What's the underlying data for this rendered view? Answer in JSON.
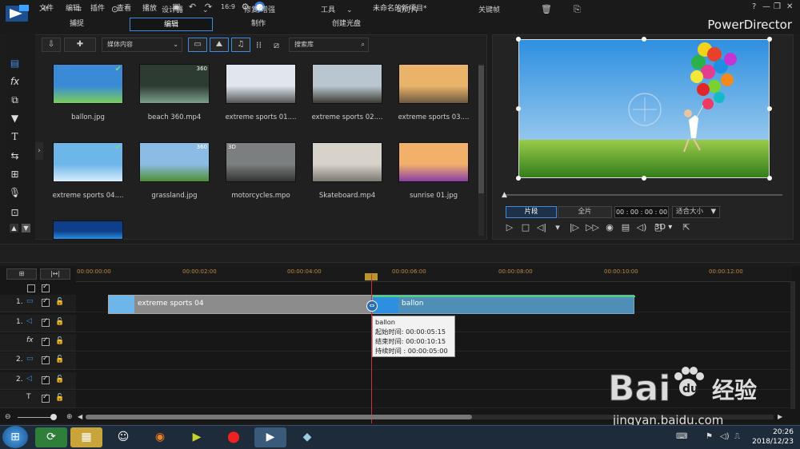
{
  "menu": [
    "文件",
    "编辑",
    "插件",
    "查看",
    "播放"
  ],
  "window_title": "未命名的新项目*",
  "brand": "PowerDirector",
  "tabs": [
    {
      "label": "捕捉"
    },
    {
      "label": "编辑"
    },
    {
      "label": "制作"
    },
    {
      "label": "创建光盘"
    }
  ],
  "library": {
    "dropdown": "媒体内容",
    "search_placeholder": "搜索库",
    "items": [
      {
        "label": "ballon.jpg",
        "colors": [
          "#3a8ad6",
          "#7ccf5a"
        ],
        "check": true
      },
      {
        "label": "beach 360.mp4",
        "colors": [
          "#2e3b33",
          "#7aa08a"
        ],
        "badge": "360"
      },
      {
        "label": "extreme sports 01....",
        "colors": [
          "#dfe6ee",
          "#555"
        ]
      },
      {
        "label": "extreme sports 02....",
        "colors": [
          "#b9c6cf",
          "#3c3a33"
        ]
      },
      {
        "label": "extreme sports 03....",
        "colors": [
          "#e9b36a",
          "#6d5940"
        ]
      },
      {
        "label": "extreme sports 04....",
        "colors": [
          "#6db6ea",
          "#d7ecfb"
        ],
        "check": true
      },
      {
        "label": "grassland.jpg",
        "colors": [
          "#8cbbe6",
          "#4f8f2f"
        ],
        "badge": "360"
      },
      {
        "label": "motorcycles.mpo",
        "colors": [
          "#7c7f80",
          "#333"
        ],
        "badge3d": "3D"
      },
      {
        "label": "Skateboard.mp4",
        "colors": [
          "#d7d2ca",
          "#7d7a73"
        ]
      },
      {
        "label": "sunrise 01.jpg",
        "colors": [
          "#f2b06a",
          "#8a3ea8"
        ]
      },
      {
        "label": "",
        "colors": [
          "#0e3f8a",
          "#2a8ee0"
        ]
      }
    ]
  },
  "preview": {
    "mode_clip": "片段",
    "mode_full": "全片",
    "timecode": "00 : 00 : 00 : 00",
    "zoom": "适合大小",
    "mode3d": "3D"
  },
  "midbar": {
    "designer": "设计器",
    "repair": "修复/增强",
    "tools": "工具",
    "slideshow": "幻灯片",
    "keyframe": "关键帧"
  },
  "ruler": [
    "00:00:00:00",
    "00:00:02:00",
    "00:00:04:00",
    "00:00:06:00",
    "00:00:08:00",
    "00:00:10:00",
    "00:00:12:00"
  ],
  "tracks": [
    {
      "num": "1.",
      "icon": "video-track-icon"
    },
    {
      "num": "1.",
      "icon": "audio-track-icon"
    },
    {
      "num": "",
      "icon": "fx-track-icon"
    },
    {
      "num": "2.",
      "icon": "video-track-icon"
    },
    {
      "num": "2.",
      "icon": "audio-track-icon"
    },
    {
      "num": "",
      "icon": "title-track-icon"
    }
  ],
  "clips": {
    "clip1": "extreme sports 04",
    "clip2": "ballon"
  },
  "tooltip": {
    "name": "ballon",
    "start": "起始时间: 00:00:05:15",
    "end": "结束时间: 00:00:10:15",
    "duration": "持续时间 : 00:00:05:00"
  },
  "clock": {
    "time": "20:26",
    "date": "2018/12/23"
  },
  "watermark": {
    "brand": "Bai",
    "brand2": "经验",
    "url": "jingyan.baidu.com"
  }
}
